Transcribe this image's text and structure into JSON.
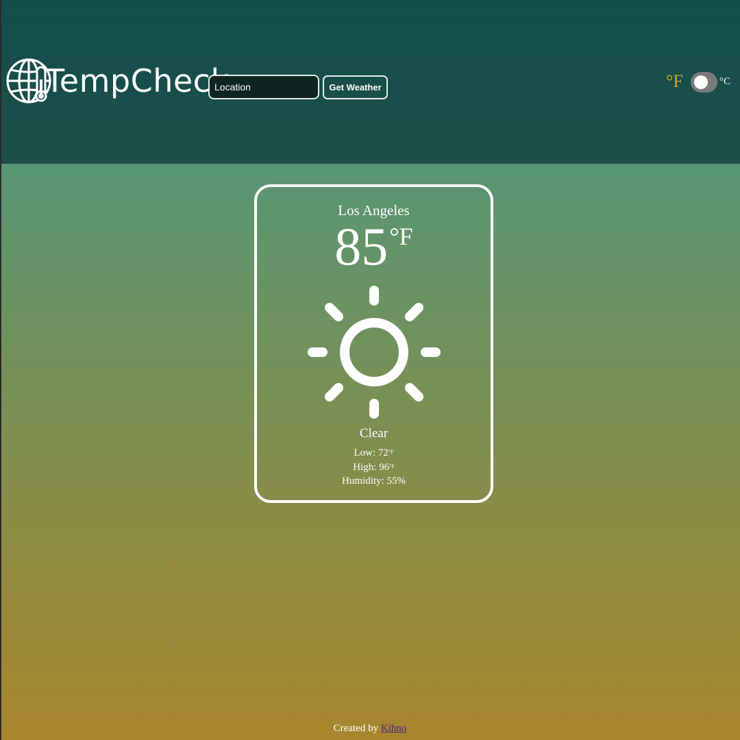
{
  "app": {
    "logo_text": "TempCheck",
    "logo_icon": "globe-thermometer-icon"
  },
  "search": {
    "placeholder": "Location",
    "value": "",
    "button_label": "Get Weather"
  },
  "unit_toggle": {
    "fahrenheit_label": "°F",
    "celsius_label": "°C",
    "selected": "F"
  },
  "weather": {
    "city": "Los Angeles",
    "temperature": "85",
    "temperature_unit": "°F",
    "icon": "sun-icon",
    "condition": "Clear",
    "low_label": "Low: ",
    "low_value": "72",
    "low_unit": "°F",
    "high_label": "High: ",
    "high_value": "96",
    "high_unit": "°F",
    "humidity": "Humidity: 55%"
  },
  "footer": {
    "text": "Created by ",
    "link_text": "Kihno"
  },
  "colors": {
    "header_top": "#134e4d",
    "header_bottom": "#1d4e48",
    "body_top": "#3f9a87",
    "body_bottom": "#a9862e",
    "fahrenheit_accent": "#d8a41f",
    "link": "#4b1f86"
  }
}
